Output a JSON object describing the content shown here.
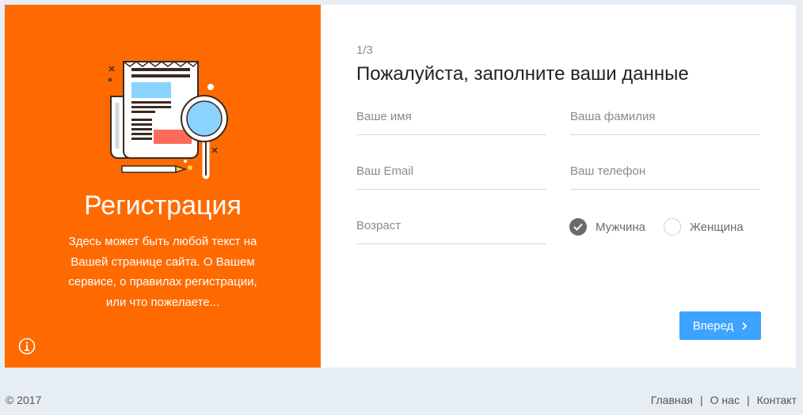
{
  "left_panel": {
    "title": "Регистрация",
    "description": "Здесь может быть любой текст на Вашей странице сайта. О Вашем сервисе, о правилах регистрации, или что пожелаете...",
    "background_color": "#ff6a00",
    "illustration_icon": "newspaper-magnifier-icon",
    "info_icon": "info-icon"
  },
  "form": {
    "step": "1/3",
    "title": "Пожалуйста, заполните ваши данные",
    "fields": {
      "first_name": {
        "placeholder": "Ваше имя",
        "value": ""
      },
      "last_name": {
        "placeholder": "Ваша фамилия",
        "value": ""
      },
      "email": {
        "placeholder": "Ваш Email",
        "value": ""
      },
      "phone": {
        "placeholder": "Ваш телефон",
        "value": ""
      },
      "age": {
        "placeholder": "Возраст",
        "value": ""
      }
    },
    "gender": {
      "options": [
        "Мужчина",
        "Женщина"
      ],
      "selected": "Мужчина"
    },
    "next_button": {
      "label": "Вперед",
      "color": "#3ea3ff"
    }
  },
  "footer": {
    "copyright": "© 2017",
    "links": [
      "Главная",
      "О нас",
      "Контакт"
    ],
    "separator": "|"
  }
}
